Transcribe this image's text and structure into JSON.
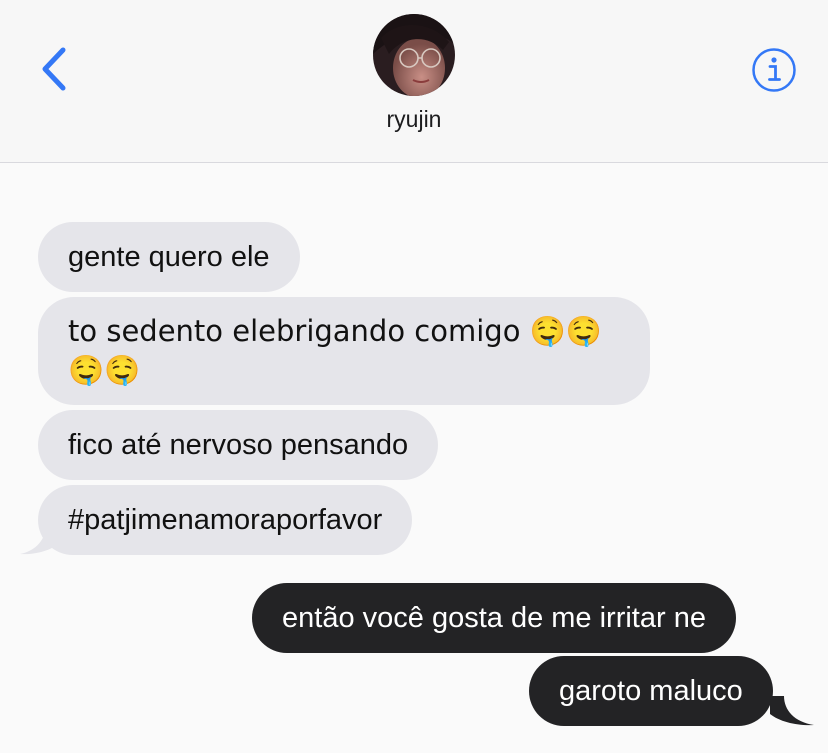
{
  "header": {
    "contact_name": "ryujin",
    "back_icon": "chevron-left-icon",
    "info_icon": "info-icon",
    "accent_color": "#3478f6"
  },
  "messages": [
    {
      "direction": "incoming",
      "text": "gente quero ele"
    },
    {
      "direction": "incoming",
      "text": "to sedento elebrigando comigo 🤤🤤🤤🤤"
    },
    {
      "direction": "incoming",
      "text": "fico até nervoso pensando"
    },
    {
      "direction": "incoming",
      "text": "#patjimenamoraporfavor"
    },
    {
      "direction": "outgoing",
      "text": "então você gosta de me irritar ne"
    },
    {
      "direction": "outgoing",
      "text": "garoto maluco"
    }
  ],
  "colors": {
    "incoming_bubble": "#e5e5ea",
    "outgoing_bubble": "#232325",
    "background": "#fafafa"
  }
}
